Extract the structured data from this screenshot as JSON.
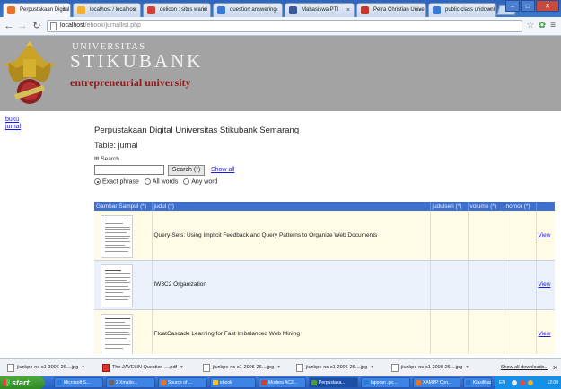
{
  "browser": {
    "tabs": [
      {
        "title": "Perpustakaan Digital",
        "color": "#e8742a",
        "active": true
      },
      {
        "title": "localhost / localhost",
        "color": "#f2b02c"
      },
      {
        "title": "delicon : situs warisi",
        "color": "#d04135"
      },
      {
        "title": "question answering",
        "color": "#3a78d6"
      },
      {
        "title": "Mahasiswa PTI",
        "color": "#3b5998"
      },
      {
        "title": "Petra Christian Unive",
        "color": "#c0392b"
      },
      {
        "title": "public class uridownl",
        "color": "#3a78d6"
      }
    ],
    "url_host": "localhost",
    "url_path": "/ebook/jurnallist.php"
  },
  "header": {
    "univ_line1": "UNIVERSITAS",
    "univ_line2": "STIKUBANK",
    "tagline": "entrepreneurial university",
    "logo_ribbon": "UNISBANK"
  },
  "sidebar": {
    "items": [
      {
        "label": "buku"
      },
      {
        "label": "jurnal"
      }
    ]
  },
  "main": {
    "title": "Perpustakaan Digital Universitas Stikubank Semarang",
    "table_label": "Table: jurnal",
    "search_legend": "Search",
    "search_value": "",
    "search_button": "Search (*)",
    "show_all": "Show all",
    "radio_options": [
      {
        "label": "Exact phrase",
        "checked": true
      },
      {
        "label": "All words",
        "checked": false
      },
      {
        "label": "Any word",
        "checked": false
      }
    ]
  },
  "table": {
    "headers": [
      "Gambar Sampul (*)",
      "judul (*)",
      "judulseri (*)",
      "volume (*)",
      "nomor (*)",
      ""
    ],
    "rows": [
      {
        "judul": "Query-Sets: Using Implicit Feedback and Query Patterns to Organize Web Documents",
        "judulseri": "",
        "volume": "",
        "nomor": "",
        "action": "View"
      },
      {
        "judul": "IW3C2 Organization",
        "judulseri": "",
        "volume": "",
        "nomor": "",
        "action": "View"
      },
      {
        "judul": "FloatCascade Learning for Fast Imbalanced Web Mining",
        "judulseri": "",
        "volume": "",
        "nomor": "",
        "action": "View"
      }
    ]
  },
  "downloads": {
    "items": [
      {
        "name": "jiunkpe-ns-s1-2006-26....jpg",
        "type": "img"
      },
      {
        "name": "The JAVELIN Question-....pdf",
        "type": "pdf"
      },
      {
        "name": "jiunkpe-ns-s1-2006-26....jpg",
        "type": "img"
      },
      {
        "name": "jiunkpe-ns-s1-2006-26....jpg",
        "type": "img"
      },
      {
        "name": "jiunkpe-ns-s1-2006-26....jpg",
        "type": "img"
      }
    ],
    "show_all": "Show all downloads..."
  },
  "taskbar": {
    "start_label": "start",
    "tasks": [
      {
        "label": "Microsoft S...",
        "color": "#2b7bd6"
      },
      {
        "label": "2 Xmatio...",
        "color": "#666666"
      },
      {
        "label": "Source of ...",
        "color": "#e8742a"
      },
      {
        "label": "ebook",
        "color": "#f2c230"
      },
      {
        "label": "Modera AC2...",
        "color": "#d04135"
      },
      {
        "label": "Perpustaka...",
        "color": "#4c9b3c",
        "active": true
      },
      {
        "label": "laporan .ge...",
        "color": "#2b7bd6"
      },
      {
        "label": "XAMPP Con...",
        "color": "#e8742a"
      },
      {
        "label": "Klasifikasi -...",
        "color": "#2b7bd6"
      }
    ],
    "tray_lang": "EN",
    "clock": "12:08"
  }
}
